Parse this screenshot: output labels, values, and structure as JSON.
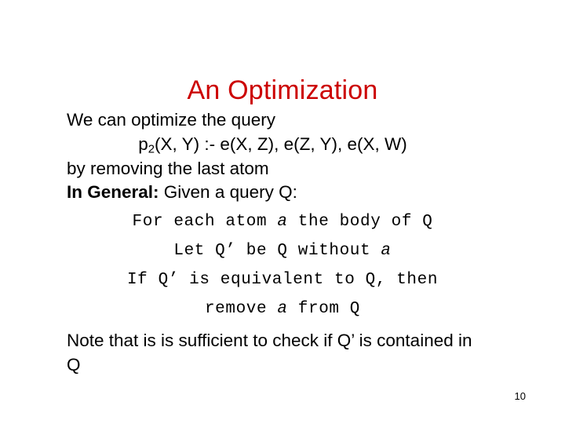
{
  "slide": {
    "title": "An Optimization",
    "title_color": "#CC0000",
    "background_color": "#FFFFFF",
    "page_number": "10",
    "bullet_glyph": "•",
    "blocks": {
      "bullet1": "We can optimize the query",
      "query_prefix": "p",
      "query_subscript": "2",
      "query_rest": "(X, Y) :- e(X, Z), e(Z, Y), e(X, W)",
      "continuation1": "by removing the last atom",
      "bullet2_bold": "In General:",
      "bullet2_rest": " Given a query Q:",
      "code": {
        "line1_a": "For each atom ",
        "line1_b": "a",
        "line1_c": " the body of Q",
        "line2_a": "Let Q’ be Q without ",
        "line2_b": "a",
        "line2_c": "",
        "line3_a": "If Q’ is equivalent to Q, then",
        "line3_b": "",
        "line3_c": "",
        "line4_a": "remove ",
        "line4_b": "a",
        "line4_c": " from Q"
      },
      "bullet3": "Note that is is sufficient to check if Q’ is contained in Q"
    }
  }
}
